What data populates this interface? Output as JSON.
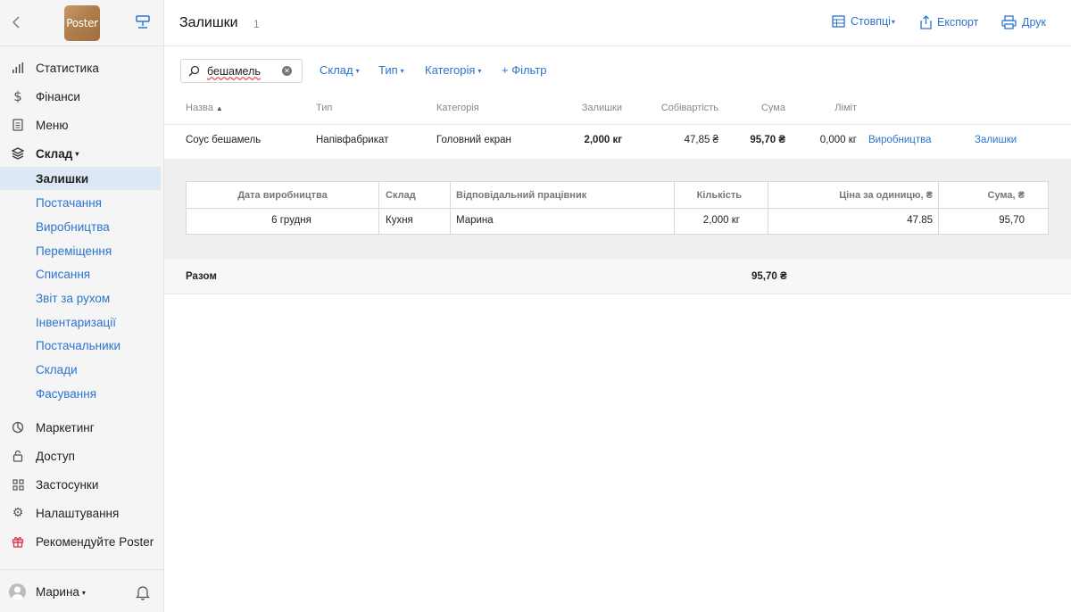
{
  "sidebar": {
    "logo_text": "Poster",
    "nav_top": [
      {
        "label": "Статистика",
        "icon": "bar-chart-icon"
      },
      {
        "label": "Фінанси",
        "icon": "dollar-icon"
      },
      {
        "label": "Меню",
        "icon": "document-icon"
      },
      {
        "label": "Склад",
        "icon": "layers-icon"
      }
    ],
    "warehouse_items": [
      {
        "label": "Залишки",
        "active": true
      },
      {
        "label": "Постачання"
      },
      {
        "label": "Виробництва"
      },
      {
        "label": "Переміщення"
      },
      {
        "label": "Списання"
      },
      {
        "label": "Звіт за рухом"
      },
      {
        "label": "Інвентаризації"
      },
      {
        "label": "Постачальники"
      },
      {
        "label": "Склади"
      },
      {
        "label": "Фасування"
      }
    ],
    "nav_bottom": [
      {
        "label": "Маркетинг",
        "icon": "marketing-icon"
      },
      {
        "label": "Доступ",
        "icon": "lock-icon"
      },
      {
        "label": "Застосунки",
        "icon": "apps-grid-icon"
      },
      {
        "label": "Налаштування",
        "icon": "gear-icon"
      },
      {
        "label": "Рекомендуйте Poster",
        "icon": "gift-icon"
      }
    ],
    "user_name": "Марина"
  },
  "header": {
    "title": "Залишки",
    "count": "1",
    "columns_label": "Стовпці",
    "export_label": "Експорт",
    "print_label": "Друк"
  },
  "filters": {
    "search_value": "бешамель",
    "warehouse": "Склад",
    "type": "Тип",
    "category": "Категорія",
    "add_filter": "+ Фільтр"
  },
  "table": {
    "headers": {
      "name": "Назва",
      "type": "Тип",
      "category": "Категорія",
      "stock": "Залишки",
      "cost": "Собівартість",
      "sum": "Сума",
      "limit": "Ліміт"
    },
    "row": {
      "name": "Соус бешамель",
      "type": "Напівфабрикат",
      "category": "Головний екран",
      "stock": "2,000 кг",
      "cost": "47,85 ₴",
      "sum": "95,70 ₴",
      "limit": "0,000 кг",
      "link_production": "Виробництва",
      "link_stock": "Залишки"
    }
  },
  "detail": {
    "headers": {
      "date": "Дата виробництва",
      "warehouse": "Склад",
      "employee": "Відповідальний працівник",
      "quantity": "Кількість",
      "unit_price": "Ціна за одиницю, ₴",
      "sum": "Сума, ₴"
    },
    "row": {
      "date": "6 грудня",
      "warehouse": "Кухня",
      "employee": "Марина",
      "quantity": "2,000 кг",
      "unit_price": "47.85",
      "sum": "95,70"
    }
  },
  "total": {
    "label": "Разом",
    "sum": "95,70 ₴"
  },
  "colors": {
    "accent": "#2c74d0",
    "active_bg": "#dde8f6",
    "gift": "#e0314b"
  }
}
